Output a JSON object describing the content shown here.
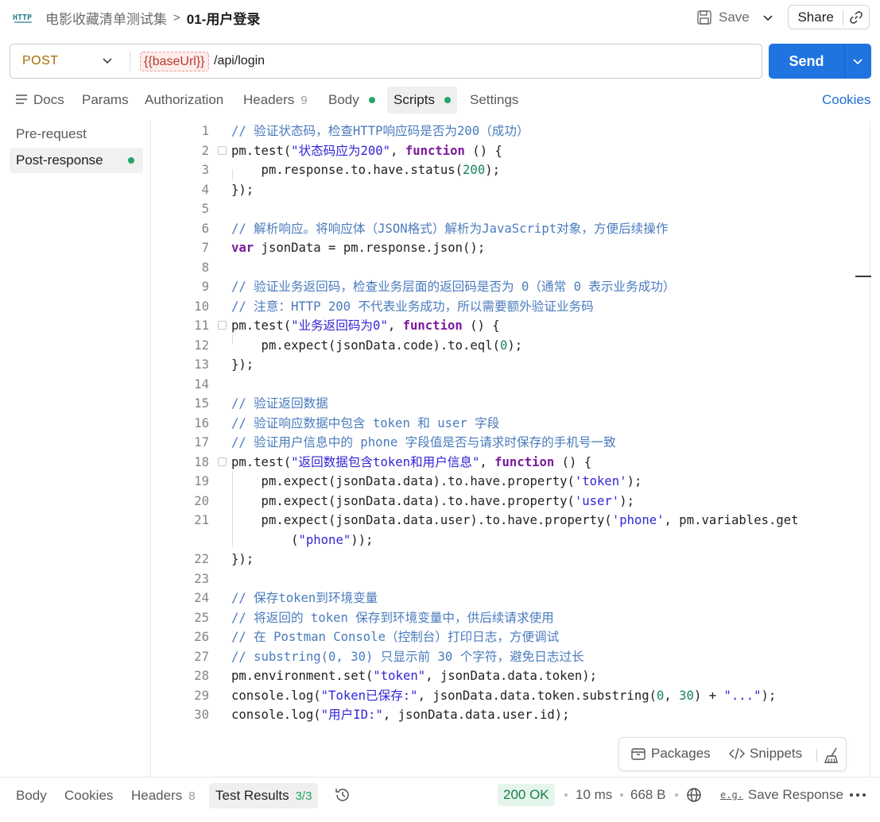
{
  "header": {
    "app_icon": "http-icon",
    "breadcrumb_parent": "电影收藏清单测试集",
    "breadcrumb_separator": ">",
    "breadcrumb_current": "01-用户登录",
    "save_label": "Save",
    "share_label": "Share"
  },
  "request": {
    "method": "POST",
    "url_variable": "{{baseUrl}}",
    "url_path": "/api/login",
    "send_label": "Send"
  },
  "tabs": {
    "docs": "Docs",
    "params": "Params",
    "authorization": "Authorization",
    "headers": "Headers",
    "headers_count": "9",
    "body": "Body",
    "scripts": "Scripts",
    "settings": "Settings",
    "cookies": "Cookies"
  },
  "scripts_nav": {
    "pre_request": "Pre-request",
    "post_response": "Post-response"
  },
  "code_lines": [
    {
      "n": "1",
      "t": "// 验证状态码，检查HTTP响应码是否为200（成功）"
    },
    {
      "n": "2",
      "t": "pm.test(\"状态码应为200\", function () {"
    },
    {
      "n": "3",
      "t": "    pm.response.to.have.status(200);"
    },
    {
      "n": "4",
      "t": "});"
    },
    {
      "n": "5",
      "t": ""
    },
    {
      "n": "6",
      "t": "// 解析响应。将响应体（JSON格式）解析为JavaScript对象，方便后续操作"
    },
    {
      "n": "7",
      "t": "var jsonData = pm.response.json();"
    },
    {
      "n": "8",
      "t": ""
    },
    {
      "n": "9",
      "t": "// 验证业务返回码，检查业务层面的返回码是否为 0（通常 0 表示业务成功）"
    },
    {
      "n": "10",
      "t": "// 注意：HTTP 200 不代表业务成功，所以需要额外验证业务码"
    },
    {
      "n": "11",
      "t": "pm.test(\"业务返回码为0\", function () {"
    },
    {
      "n": "12",
      "t": "    pm.expect(jsonData.code).to.eql(0);"
    },
    {
      "n": "13",
      "t": "});"
    },
    {
      "n": "14",
      "t": ""
    },
    {
      "n": "15",
      "t": "// 验证返回数据"
    },
    {
      "n": "16",
      "t": "// 验证响应数据中包含 token 和 user 字段"
    },
    {
      "n": "17",
      "t": "// 验证用户信息中的 phone 字段值是否与请求时保存的手机号一致"
    },
    {
      "n": "18",
      "t": "pm.test(\"返回数据包含token和用户信息\", function () {"
    },
    {
      "n": "19",
      "t": "    pm.expect(jsonData.data).to.have.property('token');"
    },
    {
      "n": "20",
      "t": "    pm.expect(jsonData.data).to.have.property('user');"
    },
    {
      "n": "21",
      "t": "    pm.expect(jsonData.data.user).to.have.property('phone', pm.variables.get"
    },
    {
      "n": "",
      "t": "        (\"phone\"));"
    },
    {
      "n": "22",
      "t": "});"
    },
    {
      "n": "23",
      "t": ""
    },
    {
      "n": "24",
      "t": "// 保存token到环境变量"
    },
    {
      "n": "25",
      "t": "// 将返回的 token 保存到环境变量中，供后续请求使用"
    },
    {
      "n": "26",
      "t": "// 在 Postman Console（控制台）打印日志，方便调试"
    },
    {
      "n": "27",
      "t": "// substring(0, 30) 只显示前 30 个字符，避免日志过长"
    },
    {
      "n": "28",
      "t": "pm.environment.set(\"token\", jsonData.data.token);"
    },
    {
      "n": "29",
      "t": "console.log(\"Token已保存:\", jsonData.data.token.substring(0, 30) + \"...\");"
    },
    {
      "n": "30",
      "t": "console.log(\"用户ID:\", jsonData.data.user.id);"
    }
  ],
  "toolbar": {
    "packages": "Packages",
    "snippets": "Snippets"
  },
  "response": {
    "body": "Body",
    "cookies": "Cookies",
    "headers": "Headers",
    "headers_count": "8",
    "test_results": "Test Results",
    "test_results_count": "3/3",
    "status": "200 OK",
    "time": "10 ms",
    "size": "668 B",
    "save_response": "Save Response",
    "save_response_prefix": "e.g."
  },
  "colors": {
    "accent": "#1f74e0",
    "method": "#a86a04",
    "success": "#22a56a",
    "comment": "#4a7bbd",
    "string": "#3225d6",
    "keyword": "#7b1a9c",
    "number": "#17855a"
  }
}
